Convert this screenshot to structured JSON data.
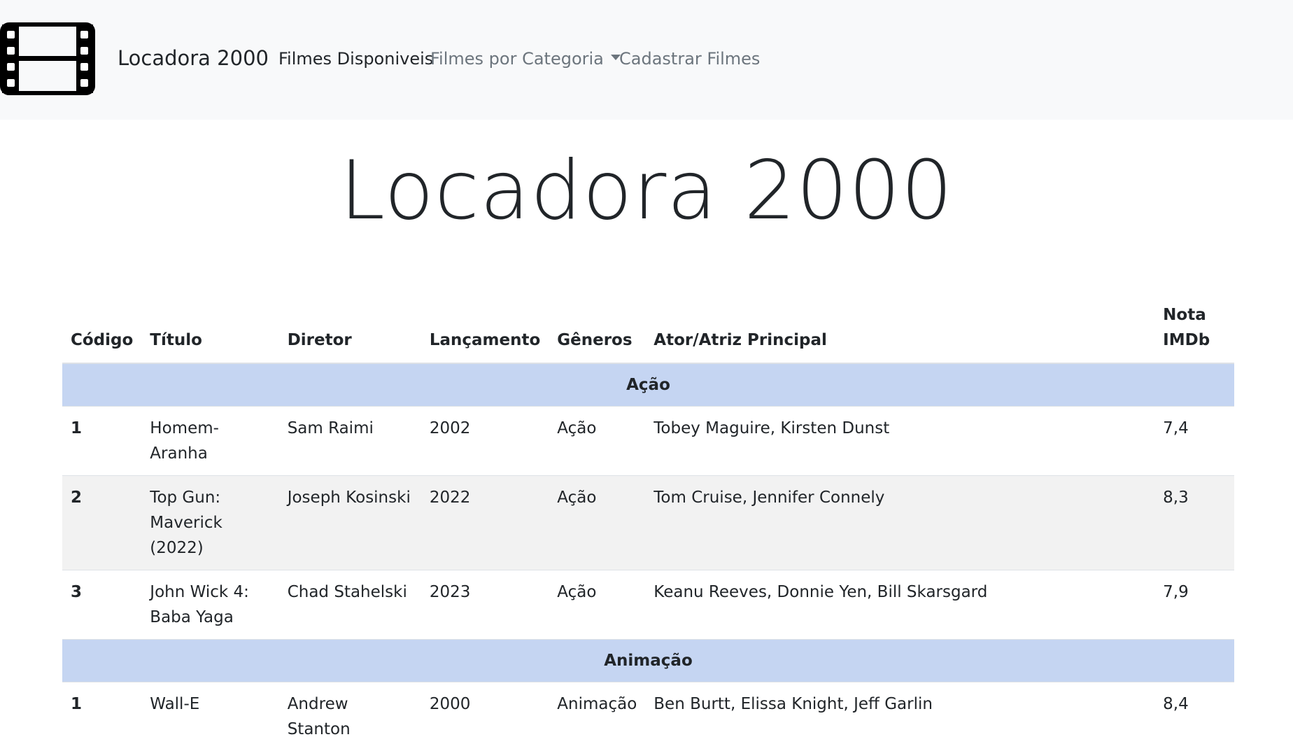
{
  "navbar": {
    "brand": "Locadora 2000",
    "links": [
      {
        "label": "Filmes Disponiveis"
      },
      {
        "label": "Filmes por Categoria"
      },
      {
        "label": "Cadastrar Filmes"
      }
    ]
  },
  "hero": {
    "title": "Locadora 2000"
  },
  "table": {
    "headers": [
      "Código",
      "Título",
      "Diretor",
      "Lançamento",
      "Gêneros",
      "Ator/Atriz Principal",
      "Nota IMDb"
    ],
    "groups": [
      {
        "name": "Ação",
        "rows": [
          {
            "codigo": "1",
            "titulo": "Homem-Aranha",
            "diretor": "Sam Raimi",
            "lancamento": "2002",
            "generos": "Ação",
            "ator": "Tobey Maguire, Kirsten Dunst",
            "nota": "7,4"
          },
          {
            "codigo": "2",
            "titulo": "Top Gun: Maverick (2022)",
            "diretor": "Joseph Kosinski",
            "lancamento": "2022",
            "generos": "Ação",
            "ator": "Tom Cruise, Jennifer Connely",
            "nota": "8,3"
          },
          {
            "codigo": "3",
            "titulo": "John Wick 4: Baba Yaga",
            "diretor": "Chad Stahelski",
            "lancamento": "2023",
            "generos": "Ação",
            "ator": "Keanu Reeves, Donnie Yen, Bill Skarsgard",
            "nota": "7,9"
          }
        ]
      },
      {
        "name": "Animação",
        "rows": [
          {
            "codigo": "1",
            "titulo": "Wall-E",
            "diretor": "Andrew Stanton",
            "lancamento": "2000",
            "generos": "Animação",
            "ator": "Ben Burtt, Elissa Knight, Jeff Garlin",
            "nota": "8,4"
          }
        ]
      }
    ]
  },
  "icons": {
    "logo": "film-icon",
    "dropdown": "caret-down-icon"
  },
  "colors": {
    "navbar_bg": "#f8f9fa",
    "group_row_bg": "#c5d5f2",
    "striped_row_bg": "#f2f2f2"
  }
}
